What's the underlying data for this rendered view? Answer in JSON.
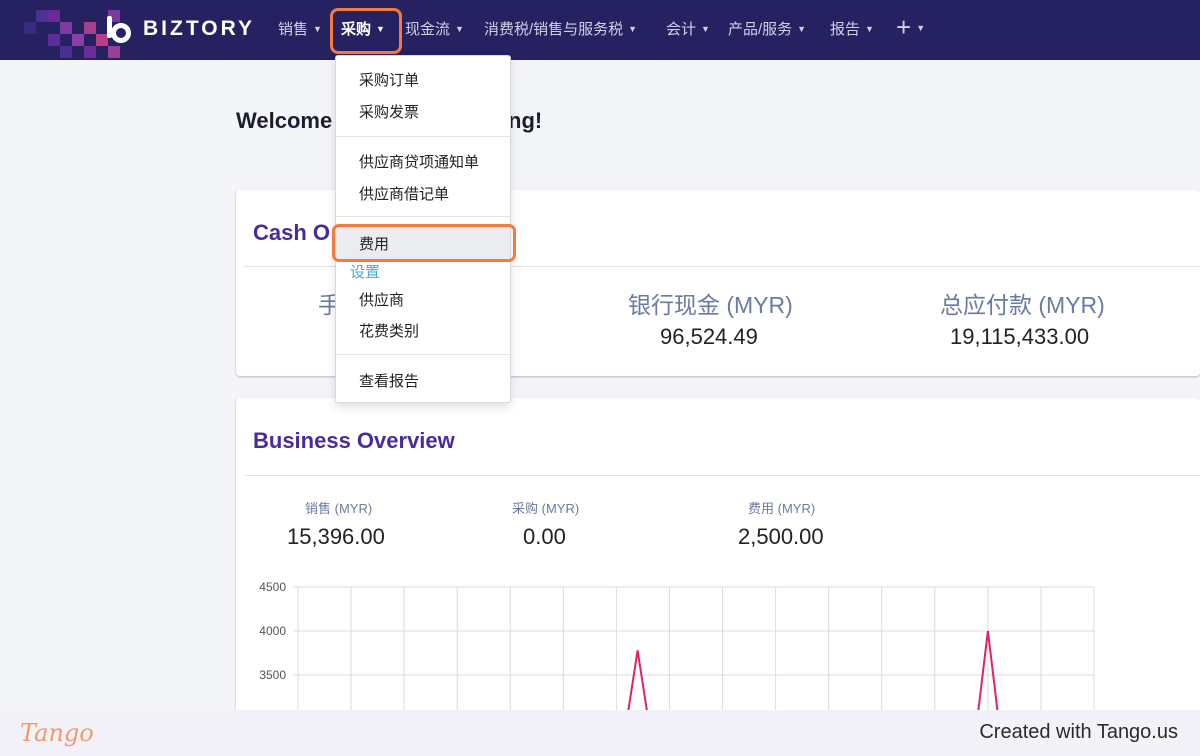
{
  "app": {
    "brand": "BIZTORY"
  },
  "nav": {
    "items": [
      {
        "label": "销售"
      },
      {
        "label": "采购"
      },
      {
        "label": "现金流"
      },
      {
        "label": "消费税/销售与服务税"
      },
      {
        "label": "会计"
      },
      {
        "label": "产品/服务"
      },
      {
        "label": "报告"
      }
    ],
    "add_icon": "plus-icon",
    "active": "采购"
  },
  "welcome": {
    "left": "Welcome",
    "right": "ng!"
  },
  "cash_overview": {
    "title_visible": "Cash O",
    "metrics": [
      {
        "label": "手",
        "value": ""
      },
      {
        "label": "银行现金 (MYR)",
        "value": "96,524.49"
      },
      {
        "label": "总应付款 (MYR)",
        "value": "19,115,433.00"
      }
    ]
  },
  "business_overview": {
    "title": "Business Overview",
    "metrics": [
      {
        "label": "销售 (MYR)",
        "value": "15,396.00"
      },
      {
        "label": "采购 (MYR)",
        "value": "0.00"
      },
      {
        "label": "费用 (MYR)",
        "value": "2,500.00"
      }
    ]
  },
  "dropdown": {
    "items": [
      {
        "label": "采购订单"
      },
      {
        "label": "采购发票"
      },
      {
        "label": "供应商贷项通知单"
      },
      {
        "label": "供应商借记单"
      },
      {
        "label": "费用"
      },
      {
        "label": "供应商"
      },
      {
        "label": "花费类别"
      },
      {
        "label": "查看报告"
      }
    ],
    "section_label": "设置",
    "selected": "费用"
  },
  "chart_data": {
    "type": "line",
    "title": "",
    "xlabel": "",
    "ylabel": "",
    "y_ticks": [
      4500,
      4000,
      3500
    ],
    "ylim": [
      3200,
      4500
    ],
    "series": [
      {
        "name": "",
        "x": [
          0,
          6.2,
          6.4,
          6.6,
          12,
          12.8,
          13,
          13.2,
          15
        ],
        "y": [
          3000,
          3000,
          3780,
          3000,
          3000,
          3000,
          4000,
          3000,
          3000
        ]
      }
    ],
    "grid": true,
    "colors": {
      "line": "#e0245e",
      "grid": "#dcdcdc"
    }
  },
  "footer": {
    "logo": "Tango",
    "credit": "Created with Tango.us"
  },
  "colors": {
    "nav_bg": "#262262",
    "accent": "#4b2a9e",
    "highlight": "#f47a3f",
    "link": "#4aa8d8"
  }
}
